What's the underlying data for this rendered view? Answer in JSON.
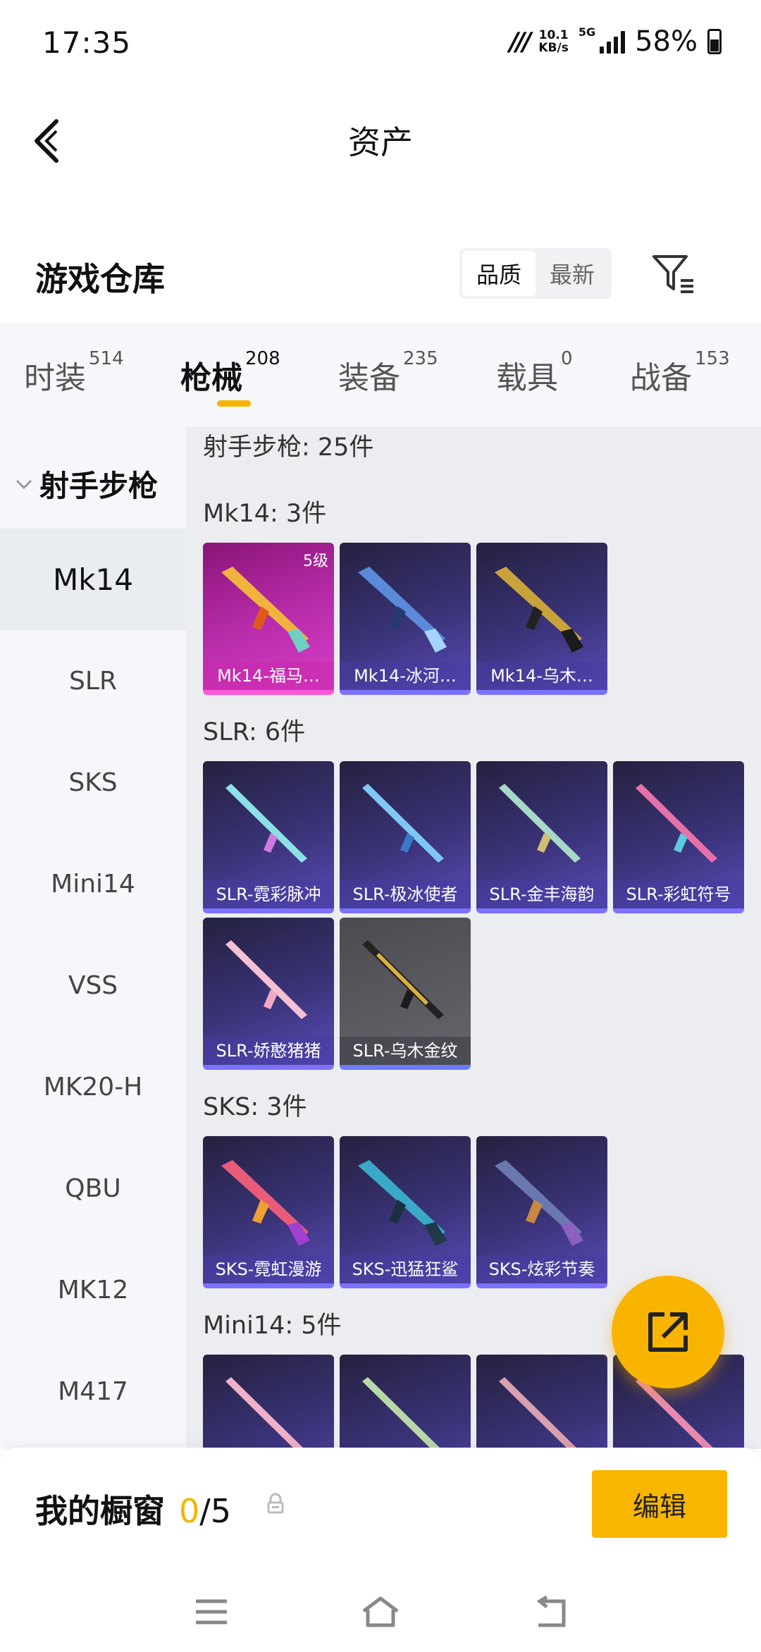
{
  "status_bar": {
    "time": "17:35",
    "net_speed_value": "10.1",
    "net_speed_unit": "KB/s",
    "network": "5G",
    "battery": "58%"
  },
  "header": {
    "title": "资产"
  },
  "warehouse": {
    "title": "游戏仓库",
    "sort_options": [
      "品质",
      "最新"
    ],
    "selected_sort": "品质"
  },
  "tabs": [
    {
      "label": "时装",
      "count": "514"
    },
    {
      "label": "枪械",
      "count": "208",
      "active": true
    },
    {
      "label": "装备",
      "count": "235"
    },
    {
      "label": "载具",
      "count": "0"
    },
    {
      "label": "战备",
      "count": "153"
    }
  ],
  "sidebar": {
    "category": "射手步枪",
    "items": [
      "Mk14",
      "SLR",
      "SKS",
      "Mini14",
      "VSS",
      "MK20-H",
      "QBU",
      "MK12",
      "M417"
    ],
    "selected": "Mk14"
  },
  "content": {
    "summary": "射手步枪: 25件",
    "sections": [
      {
        "title": "Mk14: 3件",
        "items": [
          {
            "label": "Mk14-福马…",
            "level": "5级",
            "rarity": "legendary"
          },
          {
            "label": "Mk14-冰河…",
            "rarity": "epic"
          },
          {
            "label": "Mk14-乌木…",
            "rarity": "epic"
          }
        ]
      },
      {
        "title": "SLR: 6件",
        "items": [
          {
            "label": "SLR-霓彩脉冲",
            "rarity": "epic"
          },
          {
            "label": "SLR-极冰使者",
            "rarity": "epic"
          },
          {
            "label": "SLR-金丰海韵",
            "rarity": "epic"
          },
          {
            "label": "SLR-彩虹符号",
            "rarity": "epic"
          },
          {
            "label": "SLR-娇憨猪猪",
            "rarity": "epic"
          },
          {
            "label": "SLR-乌木金纹",
            "rarity": "rare"
          }
        ]
      },
      {
        "title": "SKS: 3件",
        "items": [
          {
            "label": "SKS-霓虹漫游",
            "rarity": "epic"
          },
          {
            "label": "SKS-迅猛狂鲨",
            "rarity": "epic"
          },
          {
            "label": "SKS-炫彩节奏",
            "rarity": "epic"
          }
        ]
      },
      {
        "title": "Mini14: 5件",
        "items": [
          {
            "label": "",
            "rarity": "epic"
          },
          {
            "label": "",
            "rarity": "epic"
          },
          {
            "label": "",
            "rarity": "epic"
          },
          {
            "label": "",
            "rarity": "epic"
          }
        ]
      }
    ]
  },
  "showcase": {
    "label": "我的橱窗",
    "current": "0",
    "separator_max": "/5",
    "edit_label": "编辑"
  },
  "icons": {
    "back": "back-arrow-icon",
    "filter": "filter-icon",
    "fab": "share-export-icon",
    "lock": "lock-icon"
  },
  "colors": {
    "accent": "#F8B400",
    "card_epic": "#3A3378",
    "card_legendary": "#B62BA8"
  }
}
